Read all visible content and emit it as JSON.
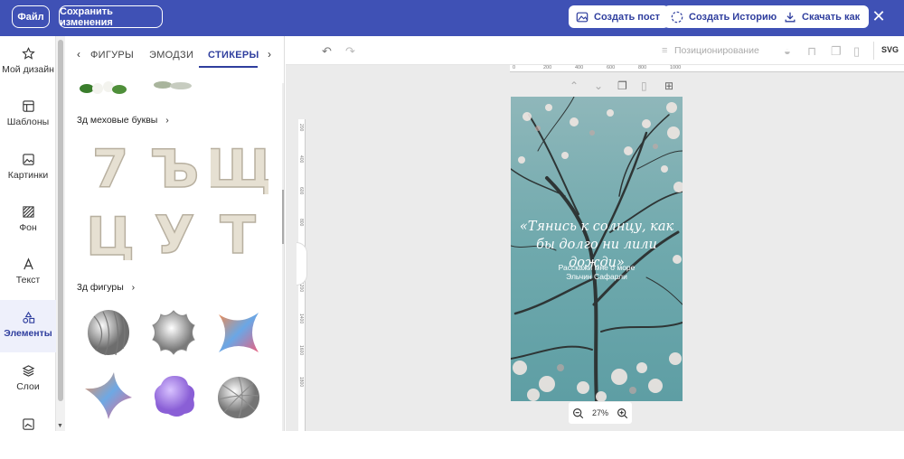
{
  "topbar": {
    "file_label": "Файл",
    "save_label": "Сохранить изменения",
    "create_post_label": "Создать пост",
    "create_story_label": "Создать Историю",
    "download_label": "Скачать как"
  },
  "nav": {
    "items": [
      {
        "label": "Мой дизайн",
        "icon": "star-icon"
      },
      {
        "label": "Шаблоны",
        "icon": "template-icon"
      },
      {
        "label": "Картинки",
        "icon": "image-icon"
      },
      {
        "label": "Фон",
        "icon": "background-icon"
      },
      {
        "label": "Текст",
        "icon": "text-icon"
      },
      {
        "label": "Элементы",
        "icon": "shapes-icon",
        "active": true
      },
      {
        "label": "Слои",
        "icon": "layers-icon"
      }
    ]
  },
  "panel": {
    "tabs": [
      "ФИГУРЫ",
      "ЭМОДЗИ",
      "СТИКЕРЫ"
    ],
    "active_tab": "СТИКЕРЫ",
    "sections": [
      {
        "title": "3д меховые буквы",
        "items": [
          "7",
          "Ъ",
          "Щ",
          "Ц",
          "У",
          "Т"
        ]
      },
      {
        "title": "3д фигуры"
      }
    ]
  },
  "toolbar": {
    "positioning_label": "Позиционирование",
    "svg_label": "SVG"
  },
  "ruler": {
    "h_ticks": [
      "0",
      "200",
      "400",
      "600",
      "800",
      "1000"
    ],
    "v_ticks": [
      "200",
      "400",
      "600",
      "800",
      "1000",
      "1200",
      "1400",
      "1600",
      "1800"
    ]
  },
  "page": {
    "quote": "«Тянись к солнцу, как бы долго ни лили дожди»",
    "book": "Расскажи мне о море",
    "author": "Эльчин Сафарли"
  },
  "zoom": {
    "value": "27%"
  },
  "colors": {
    "accent": "#3f51b5",
    "active_nav_bg": "#eef0fb"
  }
}
